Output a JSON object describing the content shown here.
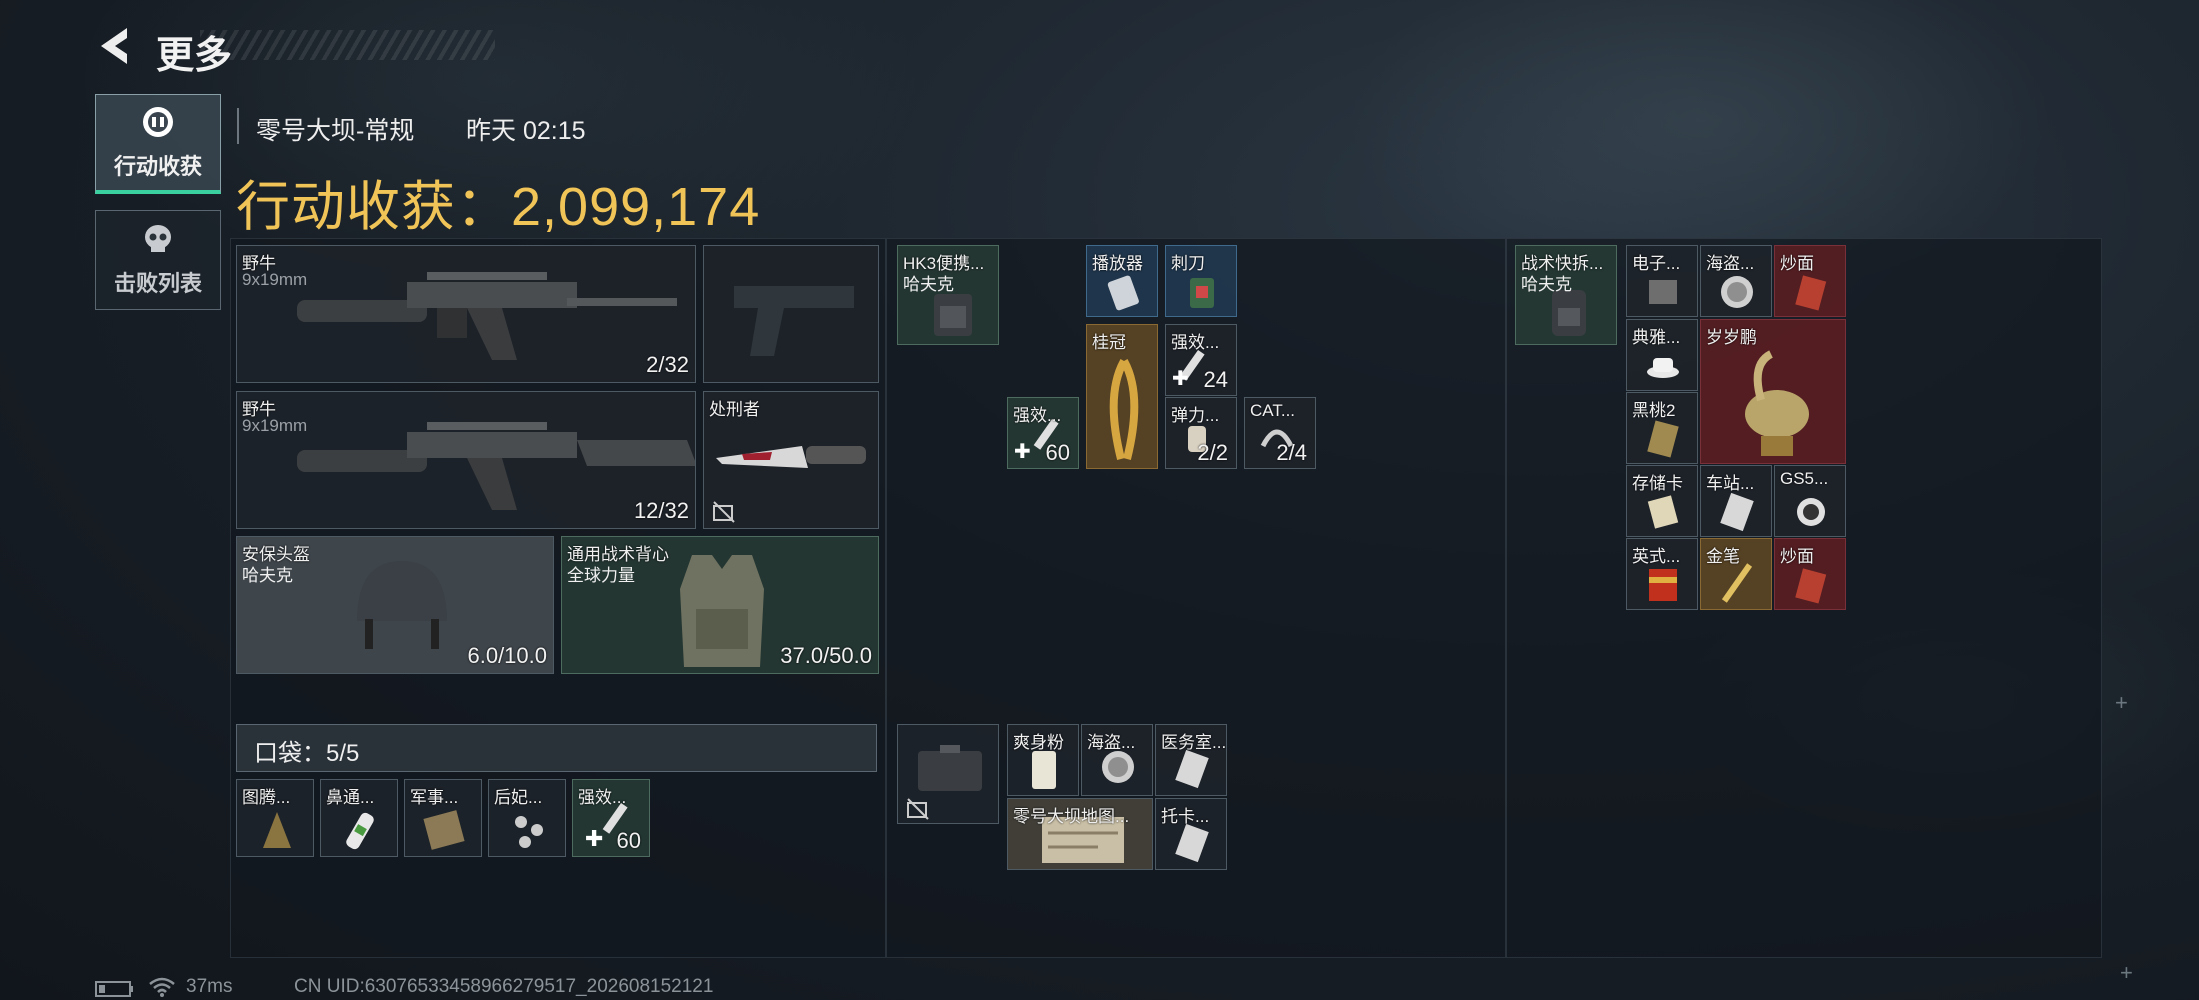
{
  "header": {
    "back_title": "更多",
    "map": "零号大坝-常规",
    "time": "昨天 02:15",
    "gain_label": "行动收获：2,099,174"
  },
  "tabs": [
    {
      "label": "行动收获",
      "active": true
    },
    {
      "label": "击败列表",
      "active": false
    }
  ],
  "equipment": {
    "weapon1": {
      "name": "野牛",
      "ammo": "9x19mm",
      "count": "2/32"
    },
    "weapon2": {
      "name": "野牛",
      "ammo": "9x19mm",
      "count": "12/32"
    },
    "melee": {
      "name": "处刑者"
    },
    "helmet": {
      "name": "安保头盔",
      "brand": "哈夫克",
      "durability": "6.0/10.0"
    },
    "armor": {
      "name": "通用战术背心",
      "brand": "全球力量",
      "durability": "37.0/50.0"
    }
  },
  "pocket": {
    "label": "口袋：",
    "count": "5/5",
    "items": [
      {
        "name": "图腾..."
      },
      {
        "name": "鼻通..."
      },
      {
        "name": "军事..."
      },
      {
        "name": "后妃..."
      },
      {
        "name": "强效...",
        "qty": "60"
      }
    ]
  },
  "chest": {
    "rig": {
      "name": "HK3便携...",
      "brand": "哈夫克"
    },
    "items": [
      {
        "name": "播放器"
      },
      {
        "name": "刺刀"
      },
      {
        "name": "桂冠"
      },
      {
        "name": "强效...",
        "qty": "24"
      },
      {
        "name": "强效...",
        "qty": "60"
      },
      {
        "name": "弹力...",
        "qty": "2/2"
      },
      {
        "name": "CAT...",
        "qty": "2/4"
      }
    ]
  },
  "case": {
    "items": [
      {
        "name": "爽身粉"
      },
      {
        "name": "海盗..."
      },
      {
        "name": "医务室..."
      },
      {
        "name": "零号大坝地图..."
      },
      {
        "name": "托卡..."
      }
    ]
  },
  "backpack": {
    "bag": {
      "name": "战术快拆...",
      "brand": "哈夫克"
    },
    "items": [
      {
        "name": "电子..."
      },
      {
        "name": "海盗..."
      },
      {
        "name": "炒面"
      },
      {
        "name": "典雅..."
      },
      {
        "name": "岁岁鹏"
      },
      {
        "name": "黑桃2"
      },
      {
        "name": "存储卡"
      },
      {
        "name": "车站..."
      },
      {
        "name": "GS5..."
      },
      {
        "name": "英式..."
      },
      {
        "name": "金笔"
      },
      {
        "name": "炒面"
      }
    ]
  },
  "status_bar": {
    "ping": "37ms",
    "uid": "CN UID:63076533458966279517_202608152121"
  },
  "colors": {
    "accent_gold": "#f1c458",
    "tab_active_underline": "#3ad0a0"
  },
  "icons": [
    "back-arrow-icon",
    "loot-icon",
    "skull-icon",
    "no-insure-icon",
    "battery-icon",
    "wifi-icon"
  ]
}
